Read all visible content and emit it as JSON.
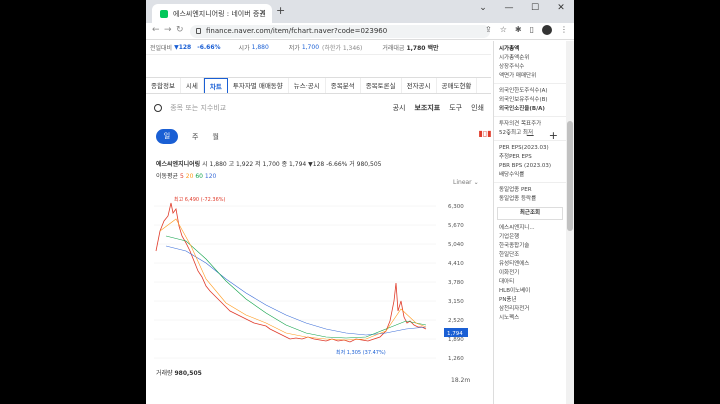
{
  "browser": {
    "tab_title": "에스씨엔지니어링 : 네이버 증권",
    "url": "finance.naver.com/item/fchart.naver?code=023960"
  },
  "quote": {
    "prev_close_label": "전일대비",
    "change": "▼128",
    "change_pct": "-6.66%",
    "open_label": "시가",
    "open": "1,880",
    "low_label": "저가",
    "low": "1,700",
    "low_limit": "(하한가 1,346)",
    "value_label": "거래대금",
    "value": "1,780 백만"
  },
  "tabs": [
    "종합정보",
    "시세",
    "차트",
    "투자자별 매매동향",
    "뉴스·공시",
    "종목분석",
    "종목토론실",
    "전자공시",
    "공매도현황"
  ],
  "search": {
    "placeholder": "종목 또는 지수비교",
    "tools": [
      "공시",
      "보조지표",
      "도구",
      "인쇄"
    ]
  },
  "periods": [
    "일",
    "주",
    "월"
  ],
  "stock_line": {
    "name": "에스씨엔지니어링",
    "text": "시 1,880  고 1,922  저 1,700  종 1,794  ▼128 -6.66%  거 980,505"
  },
  "ma_label": "이동평균",
  "ma_values": [
    "5",
    "20",
    "60",
    "120"
  ],
  "scale_mode": "Linear",
  "high_label": "최고 6,490 (-72.36%)",
  "low_label": "최저 1,305 (37.47%)",
  "last_price": "1,794",
  "axis_labels": [
    "6,300",
    "5,670",
    "5,040",
    "4,410",
    "3,780",
    "3,150",
    "2,520",
    "1,890",
    "1,260"
  ],
  "volume": {
    "label": "거래량",
    "value": "980,505",
    "axis": "18.2m"
  },
  "right_panel": {
    "title": "시가총액",
    "rows1": [
      "시가총액순위",
      "상장주식수",
      "액면가  매매단위"
    ],
    "rows2": [
      "외국인한도주식수(A)",
      "외국인보유주식수(B)",
      "외국인소진율(B/A)"
    ],
    "rows3": [
      "투자의견  목표주가",
      "52주최고  최저"
    ],
    "rows4": [
      "PER  EPS(2023.03)",
      "추정PER  EPS",
      "PBR  BPS (2023.03)",
      "배당수익률"
    ],
    "rows5": [
      "동일업종 PER",
      "동일업종 등락률"
    ],
    "recent_title": "최근조회",
    "recent": [
      "에스씨엔지니...",
      "기업은행",
      "한국종합기술",
      "한일단조",
      "유성티엔에스",
      "이화전기",
      "대아티",
      "HLB이노베이",
      "PN풍년",
      "삼천리자전거",
      "시노펙스"
    ]
  }
}
